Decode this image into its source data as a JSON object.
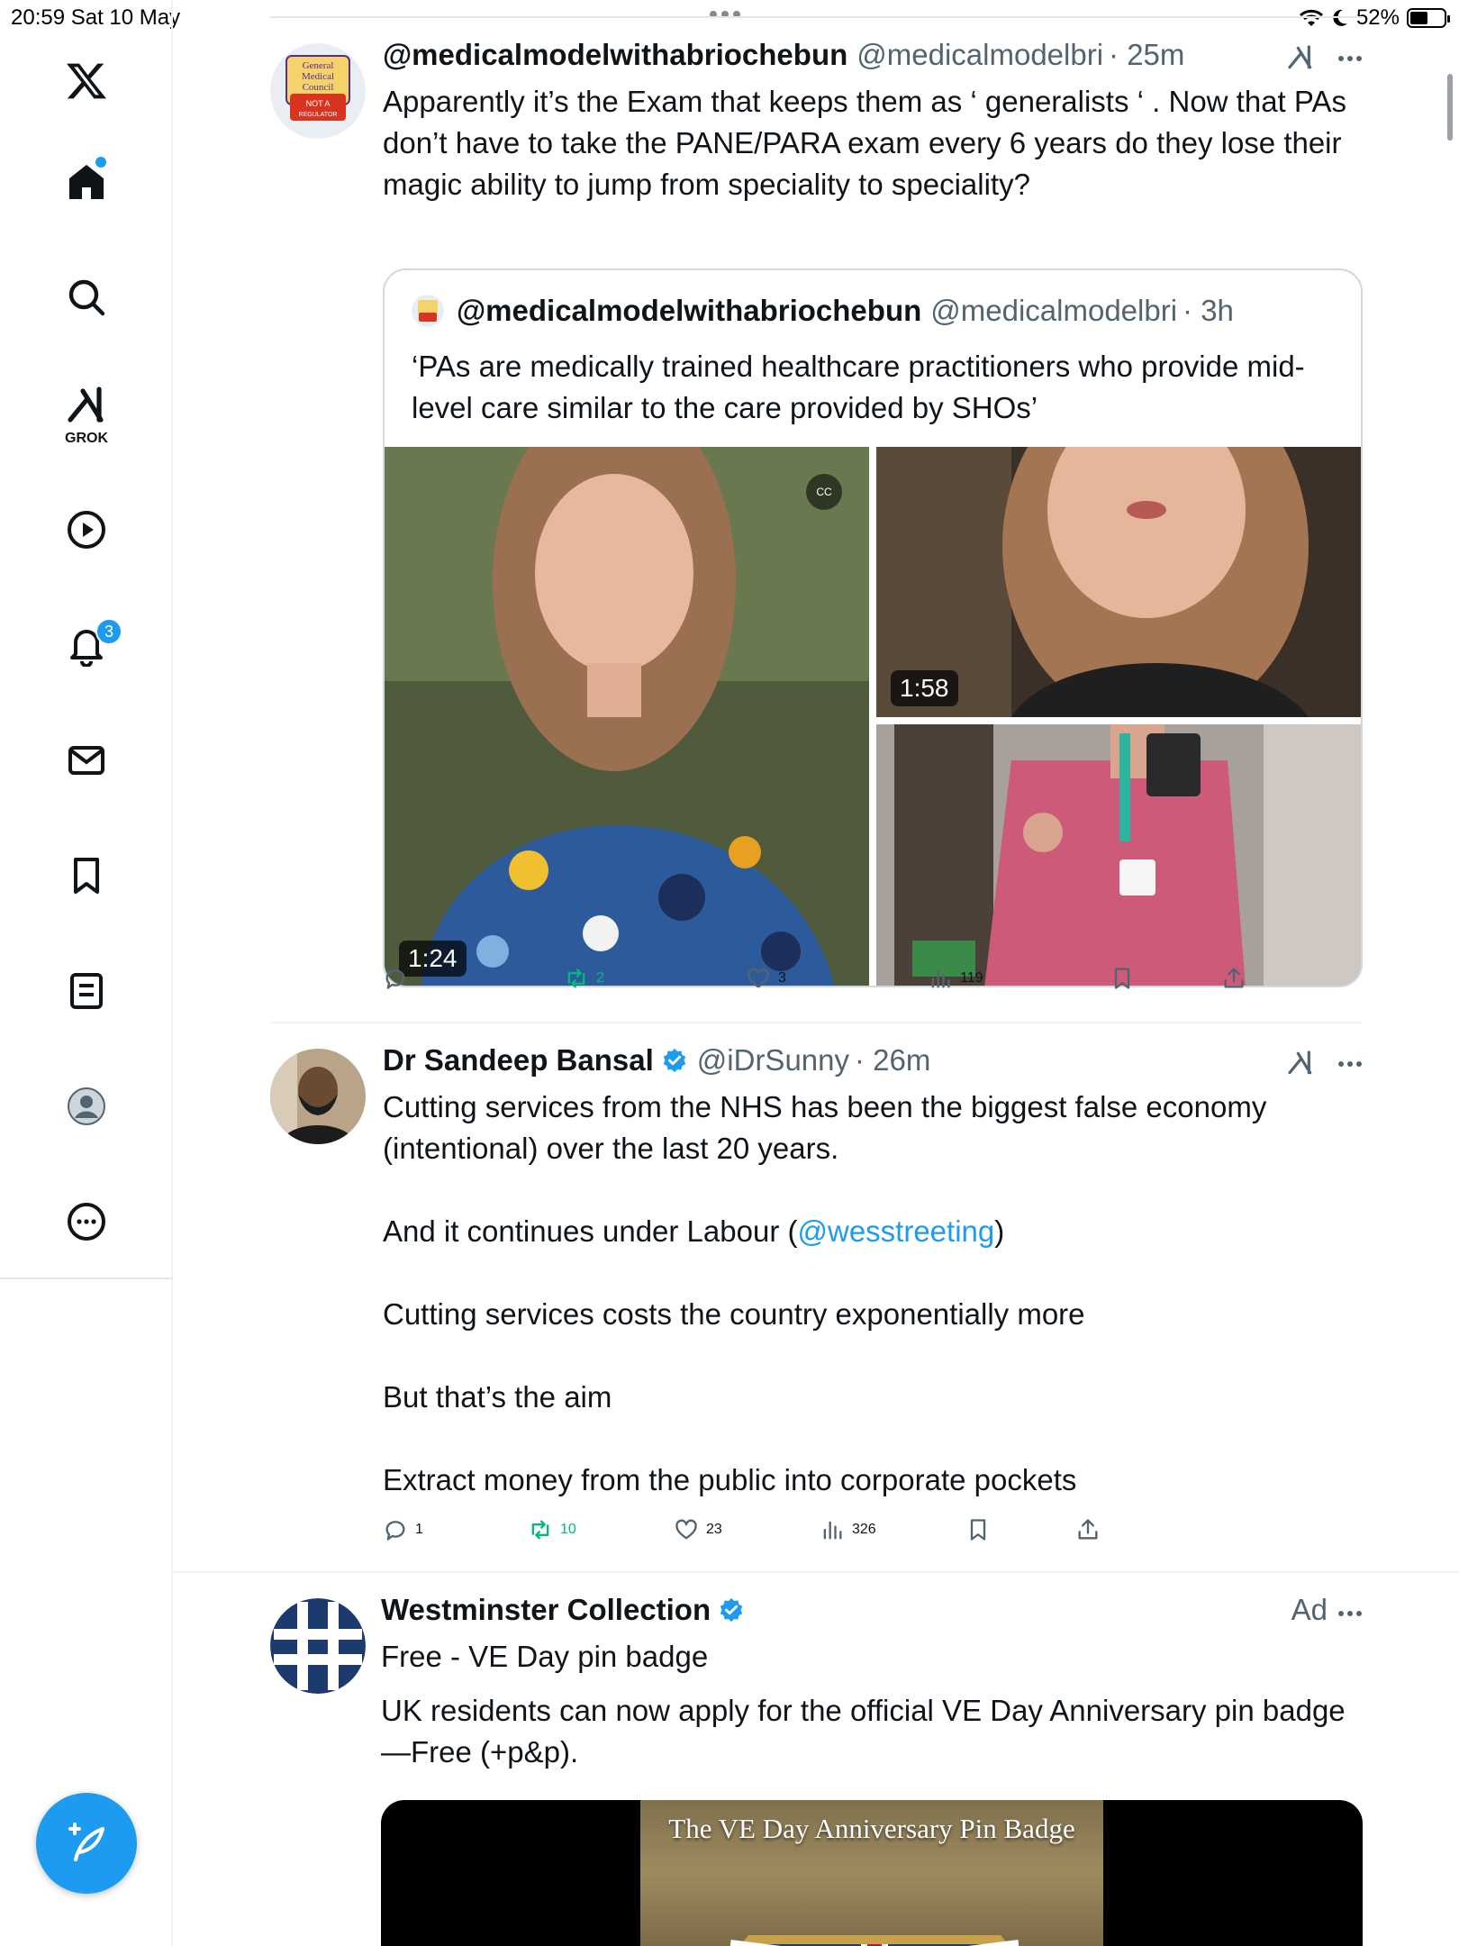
{
  "status_bar": {
    "time_date": "20:59   Sat 10 May",
    "battery_percent": "52%",
    "battery_level": 0.52
  },
  "sidebar": {
    "grok_label": "GROK",
    "notifications_count": "3",
    "items": [
      "x-logo",
      "home",
      "search",
      "grok",
      "videos",
      "notifications",
      "messages",
      "bookmarks",
      "lists",
      "profile",
      "more"
    ]
  },
  "tweets": [
    {
      "name": "@medicalmodelwithabriochebun",
      "handle": "@medicalmodelbri",
      "time": "· 25m",
      "avatar_text": "General Medical Council NOT A REGULATOR",
      "text": "Apparently it’s the Exam that keeps them as ‘ generalists ‘ . Now that PAs don’t have to take the PANE/PARA  exam every 6 years do they lose their magic ability to jump from speciality to speciality?",
      "quote": {
        "name": "@medicalmodelwithabriochebun",
        "handle": "@medicalmodelbri",
        "time": "· 3h",
        "text": "‘PAs are medically trained healthcare practitioners who provide mid- level care similar to the care provided by SHOs’",
        "media": [
          {
            "duration": "1:24",
            "cc": "CC"
          },
          {
            "duration": "1:58"
          },
          {
            "duration": ""
          }
        ]
      },
      "stats": {
        "replies": "",
        "retweets": "2",
        "likes": "3",
        "views": "119"
      }
    },
    {
      "name": "Dr Sandeep Bansal",
      "handle": "@iDrSunny",
      "time": "· 26m",
      "verified": true,
      "paragraphs": [
        "Cutting services from the NHS has been the biggest false economy (intentional) over the last 20 years.",
        "And it continues under Labour (",
        "@wesstreeting",
        ")",
        "Cutting services costs the country exponentially more",
        "But that’s the aim",
        "Extract money from the public into corporate pockets"
      ],
      "stats": {
        "replies": "1",
        "retweets": "10",
        "likes": "23",
        "views": "326"
      }
    },
    {
      "name": "Westminster Collection",
      "verified": true,
      "ad_label": "Ad",
      "headline": "Free - VE Day pin badge",
      "text": "UK residents can now apply for the official VE Day Anniversary pin badge—Free (+p&p).",
      "banner_title": "The VE Day Anniversary Pin Badge"
    }
  ],
  "colors": {
    "accent": "#1d9bf0",
    "retweet": "#00ba7c",
    "secondary_text": "#536471",
    "border": "#eff3f4"
  }
}
